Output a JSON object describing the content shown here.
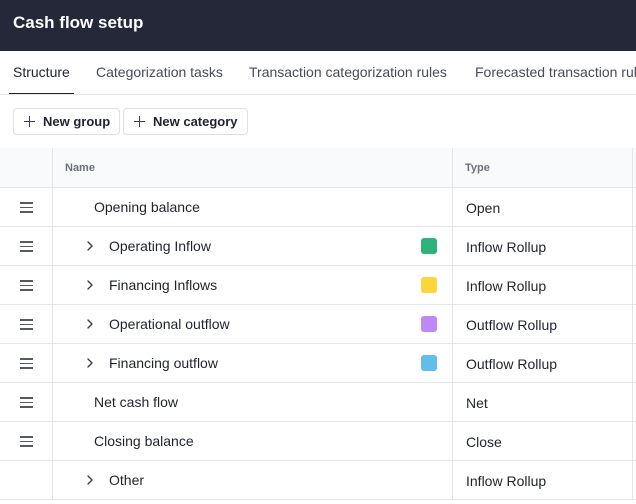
{
  "header": {
    "title": "Cash flow setup"
  },
  "tabs": [
    {
      "label": "Structure",
      "active": true
    },
    {
      "label": "Categorization tasks",
      "active": false
    },
    {
      "label": "Transaction categorization rules",
      "active": false
    },
    {
      "label": "Forecasted transaction rules",
      "active": false
    }
  ],
  "toolbar": {
    "new_group_label": "New group",
    "new_category_label": "New category"
  },
  "table": {
    "columns": {
      "name": "Name",
      "type": "Type"
    },
    "rows": [
      {
        "name": "Opening balance",
        "type": "Open",
        "expandable": false,
        "color": null,
        "draggable": true
      },
      {
        "name": "Operating Inflow",
        "type": "Inflow Rollup",
        "expandable": true,
        "color": "#2db37a",
        "draggable": true
      },
      {
        "name": "Financing Inflows",
        "type": "Inflow Rollup",
        "expandable": true,
        "color": "#fcd53a",
        "draggable": true
      },
      {
        "name": "Operational outflow",
        "type": "Outflow Rollup",
        "expandable": true,
        "color": "#c088f5",
        "draggable": true
      },
      {
        "name": "Financing outflow",
        "type": "Outflow Rollup",
        "expandable": true,
        "color": "#62bdee",
        "draggable": true
      },
      {
        "name": "Net cash flow",
        "type": "Net",
        "expandable": false,
        "color": null,
        "draggable": true
      },
      {
        "name": "Closing balance",
        "type": "Close",
        "expandable": false,
        "color": null,
        "draggable": true
      },
      {
        "name": "Other",
        "type": "Inflow Rollup",
        "expandable": true,
        "color": null,
        "draggable": false
      }
    ]
  }
}
